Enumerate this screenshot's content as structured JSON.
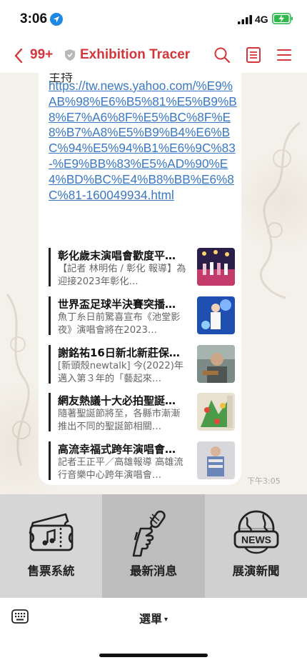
{
  "status_bar": {
    "time": "3:06",
    "network": "4G"
  },
  "header": {
    "unread_count": "99+",
    "title": "Exhibition Tracer"
  },
  "message": {
    "partial_text": "主持",
    "link": "https://tw.news.yahoo.com/%E9%AB%98%E6%B5%81%E5%B9%B8%E7%A6%8F%E5%BC%8F%E8%B7%A8%E5%B9%B4%E6%BC%94%E5%94%B1%E6%9C%83-%E9%BB%83%E5%AD%90%E4%BD%BC%E4%B8%BB%E6%8C%81-160049934.html",
    "time": "下午3:05"
  },
  "news": [
    {
      "title": "彰化歲末演唱會歡度平…",
      "summary": "【記者 林明佑 / 彰化 報導】為迎接2023年彰化…"
    },
    {
      "title": "世界盃足球半決賽突播…",
      "summary": "魚丁糸日前驚喜宣布《池堂影夜》演唱會將在2023…"
    },
    {
      "title": "謝銘祐16日新北新莊保…",
      "summary": "[新頭殼newtalk] 今(2022)年邁入第３年的「藝起來…"
    },
    {
      "title": "網友熱議十大必拍聖誕…",
      "summary": "隨著聖誕節將至，各縣市漸漸推出不同的聖誕節相關…"
    },
    {
      "title": "高流幸福式跨年演唱會…",
      "summary": "記者王正平／高雄報導 高雄流行音樂中心跨年演唱會…"
    }
  ],
  "rich_menu": {
    "tickets_label": "售票系統",
    "news_label": "最新消息",
    "exhibition_label": "展演新聞",
    "news_icon_text": "NEWS"
  },
  "bottom_bar": {
    "menu_label": "選單",
    "caret": "▾"
  },
  "colors": {
    "accent": "#d4363b",
    "link": "#3a78c4"
  }
}
